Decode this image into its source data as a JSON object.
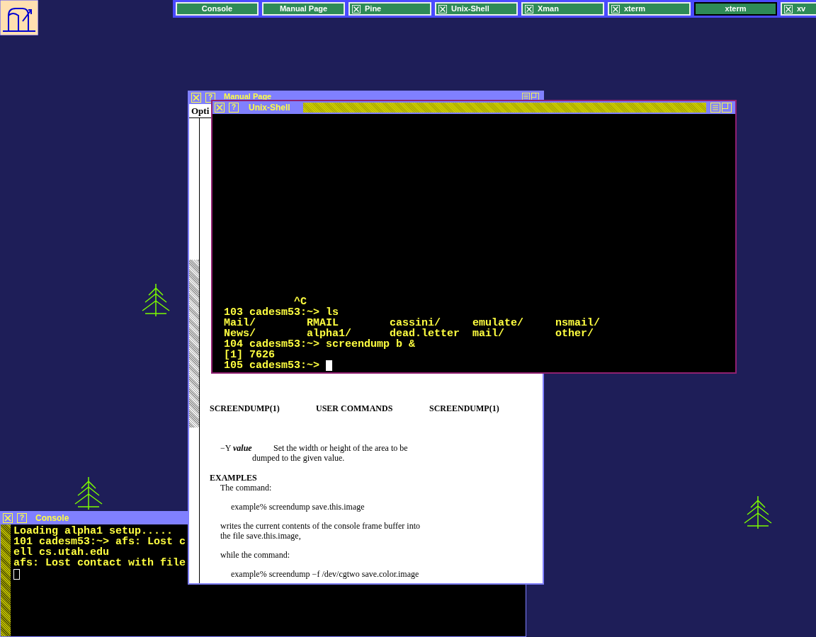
{
  "taskbar": [
    {
      "label": "Console",
      "kind": "plain",
      "selected": false
    },
    {
      "label": "Manual Page",
      "kind": "plain",
      "selected": false
    },
    {
      "label": "Pine",
      "kind": "iconified",
      "selected": false
    },
    {
      "label": "Unix-Shell",
      "kind": "iconified",
      "selected": false
    },
    {
      "label": "Xman",
      "kind": "iconified",
      "selected": false
    },
    {
      "label": "xterm",
      "kind": "iconified",
      "selected": false
    },
    {
      "label": "xterm",
      "kind": "plain",
      "selected": true
    },
    {
      "label": "xv",
      "kind": "iconified",
      "selected": false
    }
  ],
  "console": {
    "title": "Console",
    "help_button": "?",
    "lines": [
      "Loading alpha1 setup.....",
      "101 cadesm53:~> afs: Lost c",
      "ell cs.utah.edu",
      "afs: Lost contact with file"
    ]
  },
  "manual_page": {
    "title": "Manual Page",
    "help_button": "?",
    "menu_item": "Opti",
    "header": [
      "SCREENDUMP(1)",
      "USER COMMANDS",
      "SCREENDUMP(1)"
    ],
    "option": {
      "term": "−Y *value*",
      "description": "Set the width or height of the area to be dumped to the given value."
    },
    "section": "EXAMPLES",
    "body": [
      {
        "kind": "text",
        "text": "The command:"
      },
      {
        "kind": "example",
        "text": "example% screendump save.this.image"
      },
      {
        "kind": "text",
        "text": "writes the current contents of the console frame buffer into the file save.this.image,"
      },
      {
        "kind": "text",
        "text": "while the command:"
      },
      {
        "kind": "example",
        "text": "example% screendump −f /dev/cgtwo save.color.image"
      }
    ]
  },
  "unix_shell": {
    "title": "Unix-Shell",
    "help_button": "?",
    "lines": [
      "           ^C",
      "103 cadesm53:~> ls",
      "Mail/        RMAIL        cassini/     emulate/     nsmail/",
      "News/        alpha1/      dead.letter  mail/        other/",
      "104 cadesm53:~> screendump b &",
      "[1] 7626"
    ],
    "prompt": "105 cadesm53:~> "
  }
}
